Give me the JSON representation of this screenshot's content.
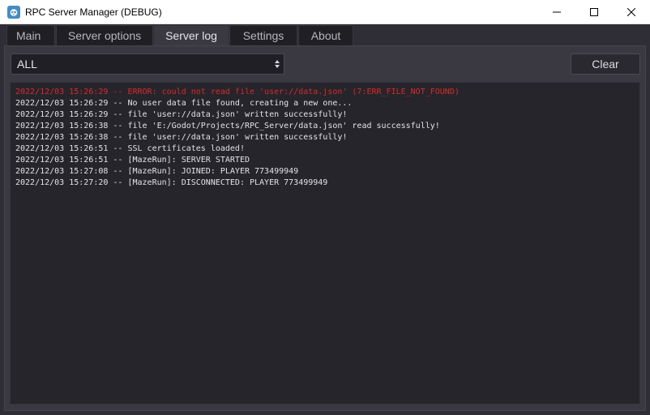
{
  "window": {
    "title": "RPC Server Manager (DEBUG)"
  },
  "tabs": [
    {
      "label": "Main",
      "active": false
    },
    {
      "label": "Server options",
      "active": false
    },
    {
      "label": "Server log",
      "active": true
    },
    {
      "label": "Settings",
      "active": false
    },
    {
      "label": "About",
      "active": false
    }
  ],
  "toolbar": {
    "filter_value": "ALL",
    "clear_label": "Clear"
  },
  "log": [
    {
      "text": "2022/12/03 15:26:29 -- ERROR: could not read file 'user://data.json' (7:ERR_FILE_NOT_FOUND)",
      "level": "error"
    },
    {
      "text": "2022/12/03 15:26:29 -- No user data file found, creating a new one...",
      "level": "info"
    },
    {
      "text": "2022/12/03 15:26:29 -- file 'user://data.json' written successfully!",
      "level": "info"
    },
    {
      "text": "2022/12/03 15:26:38 -- file 'E:/Godot/Projects/RPC_Server/data.json' read successfully!",
      "level": "info"
    },
    {
      "text": "2022/12/03 15:26:38 -- file 'user://data.json' written successfully!",
      "level": "info"
    },
    {
      "text": "2022/12/03 15:26:51 -- SSL certificates loaded!",
      "level": "info"
    },
    {
      "text": "2022/12/03 15:26:51 -- [MazeRun]: SERVER STARTED",
      "level": "info"
    },
    {
      "text": "2022/12/03 15:27:08 -- [MazeRun]: JOINED: PLAYER 773499949",
      "level": "info"
    },
    {
      "text": "2022/12/03 15:27:20 -- [MazeRun]: DISCONNECTED: PLAYER 773499949",
      "level": "info"
    }
  ],
  "colors": {
    "error": "#d62a2a",
    "info": "#e4e2e8",
    "accent": "#478cbf"
  },
  "icons": {
    "app": "godot-icon",
    "minimize": "minimize-icon",
    "maximize": "maximize-icon",
    "close": "close-icon",
    "select": "select-arrows-icon"
  }
}
